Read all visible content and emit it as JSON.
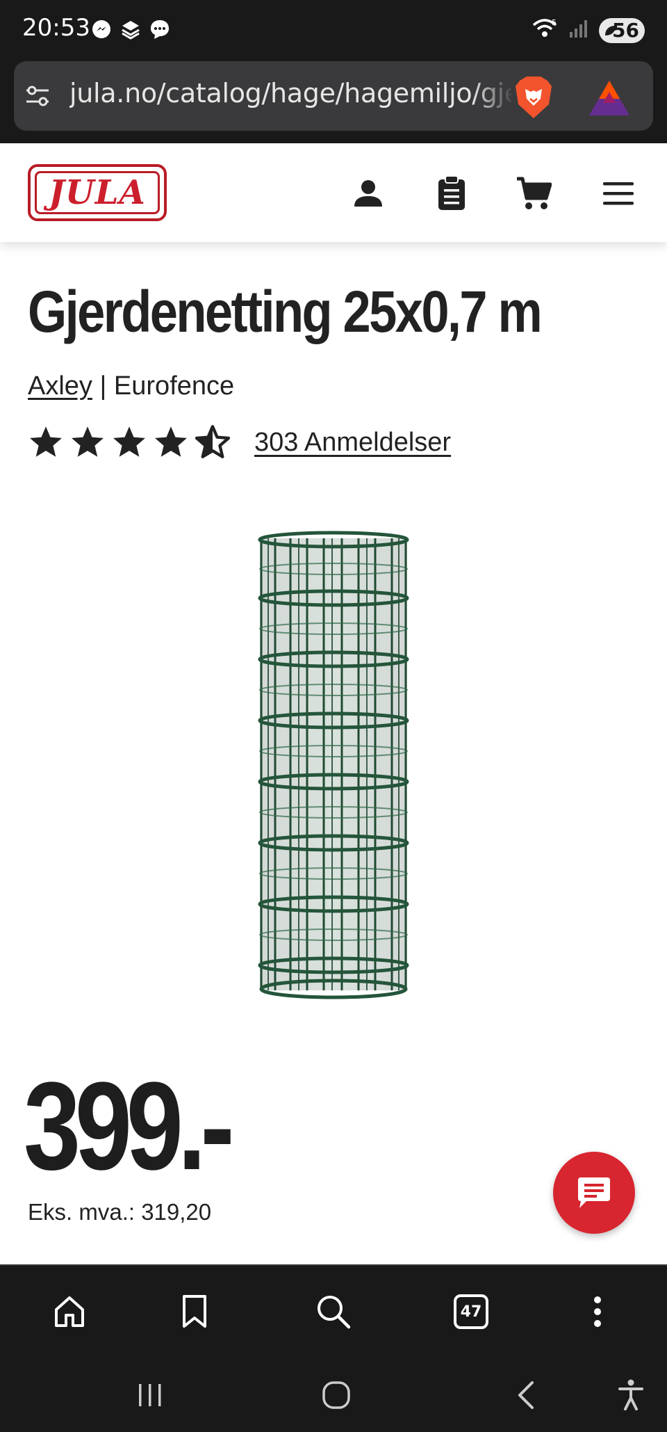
{
  "status_bar": {
    "time": "20:53",
    "battery": "56",
    "notification_icons": [
      "messenger-icon",
      "layers-icon",
      "chat-bubble-icon"
    ],
    "right_icons": [
      "wifi-icon",
      "signal-icon",
      "battery-icon"
    ]
  },
  "browser": {
    "url": "jula.no/catalog/hage/hagemiljo/gjerdenetting",
    "tab_count": "47",
    "toolbar": [
      "home-icon",
      "bookmark-icon",
      "search-icon",
      "tabs-icon",
      "more-icon"
    ]
  },
  "site_header": {
    "logo_text": "JULA",
    "icons": [
      "account-icon",
      "shopping-list-icon",
      "cart-icon",
      "menu-icon"
    ]
  },
  "product": {
    "title": "Gjerdenetting 25x0,7 m",
    "brand": "Axley",
    "brand_separator": " | ",
    "series": "Eurofence",
    "rating": 4.5,
    "rating_max": 5,
    "reviews": "303 Anmeldelser",
    "price": "399.-",
    "price_ex_vat": "Eks. mva.: 319,20"
  },
  "colors": {
    "brand_red": "#d7262f",
    "text_dark": "#222222",
    "chrome_dark": "#191919",
    "fence_green": "#1f4a32"
  }
}
